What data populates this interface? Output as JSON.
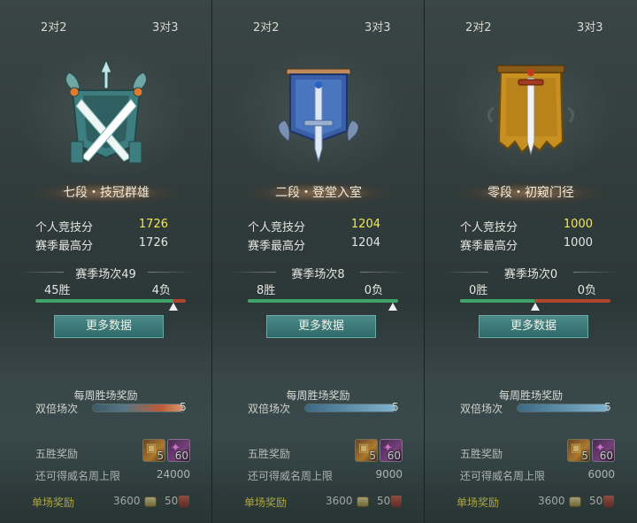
{
  "colors": {
    "highlight_yellow": "#f5e84a",
    "win_green": "#3ea26a",
    "loss_red": "#b0452d",
    "button_teal": "#2f6a6a"
  },
  "panels": [
    {
      "tab_left": "2对2",
      "tab_right": "3对3",
      "emblem_icon": "crossed-swords-emblem-icon",
      "rank_name": "七段・技冠群雄",
      "personal_score_label": "个人竞技分",
      "personal_score": "1726",
      "season_high_label": "赛季最高分",
      "season_high": "1726",
      "season_matches": "赛季场次49",
      "wins": "45胜",
      "losses": "4负",
      "win_fraction": 0.918,
      "more_data_label": "更多数据",
      "weekly_reward_title": "每周胜场奖励",
      "double_label": "双倍场次",
      "double_count": "5",
      "double_fraction": 1.0,
      "double_style": "fire",
      "five_win_label": "五胜奖励",
      "item1_count": "5",
      "item1_icon": "treasure-chest-icon",
      "item2_count": "60",
      "item2_icon": "purple-gem-icon",
      "cap_label": "还可得威名周上限",
      "cap_value": "24000",
      "single_label": "单场奖励",
      "single_coin": "3600",
      "single_honor": "50"
    },
    {
      "tab_left": "2对2",
      "tab_right": "3对3",
      "emblem_icon": "sword-banner-emblem-icon",
      "rank_name": "二段・登堂入室",
      "personal_score_label": "个人竞技分",
      "personal_score": "1204",
      "season_high_label": "赛季最高分",
      "season_high": "1204",
      "season_matches": "赛季场次8",
      "wins": "8胜",
      "losses": "0负",
      "win_fraction": 1.0,
      "more_data_label": "更多数据",
      "weekly_reward_title": "每周胜场奖励",
      "double_label": "双倍场次",
      "double_count": "5",
      "double_fraction": 1.0,
      "double_style": "blue",
      "five_win_label": "五胜奖励",
      "item1_count": "5",
      "item1_icon": "treasure-chest-icon",
      "item2_count": "60",
      "item2_icon": "purple-gem-icon",
      "cap_label": "还可得威名周上限",
      "cap_value": "9000",
      "single_label": "单场奖励",
      "single_coin": "3600",
      "single_honor": "50"
    },
    {
      "tab_left": "2对2",
      "tab_right": "3对3",
      "emblem_icon": "gold-banner-sword-emblem-icon",
      "rank_name": "零段・初窥门径",
      "personal_score_label": "个人竞技分",
      "personal_score": "1000",
      "season_high_label": "赛季最高分",
      "season_high": "1000",
      "season_matches": "赛季场次0",
      "wins": "0胜",
      "losses": "0负",
      "win_fraction": 0.5,
      "more_data_label": "更多数据",
      "weekly_reward_title": "每周胜场奖励",
      "double_label": "双倍场次",
      "double_count": "5",
      "double_fraction": 1.0,
      "double_style": "blue",
      "five_win_label": "五胜奖励",
      "item1_count": "5",
      "item1_icon": "treasure-chest-icon",
      "item2_count": "60",
      "item2_icon": "purple-gem-icon",
      "cap_label": "还可得威名周上限",
      "cap_value": "6000",
      "single_label": "单场奖励",
      "single_coin": "3600",
      "single_honor": "50"
    }
  ]
}
